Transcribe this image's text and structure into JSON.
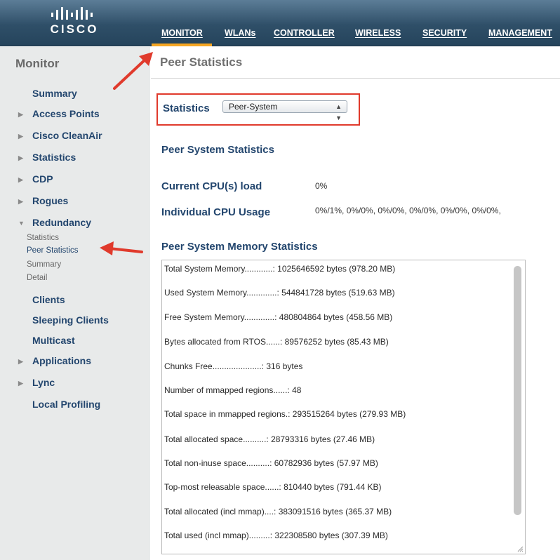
{
  "header": {
    "logo_text": "CISCO",
    "nav": [
      {
        "label": "MONITOR",
        "active": true
      },
      {
        "label": "WLANs",
        "active": false
      },
      {
        "label": "CONTROLLER",
        "active": false
      },
      {
        "label": "WIRELESS",
        "active": false
      },
      {
        "label": "SECURITY",
        "active": false
      },
      {
        "label": "MANAGEMENT",
        "active": false
      }
    ]
  },
  "sidebar": {
    "title": "Monitor",
    "items": [
      {
        "label": "Summary",
        "caret": ""
      },
      {
        "label": "Access Points",
        "caret": "▶"
      },
      {
        "label": "Cisco CleanAir",
        "caret": "▶"
      },
      {
        "label": "Statistics",
        "caret": "▶"
      },
      {
        "label": "CDP",
        "caret": "▶"
      },
      {
        "label": "Rogues",
        "caret": "▶"
      },
      {
        "label": "Redundancy",
        "caret": "▼"
      }
    ],
    "redundancy_sub": [
      "Statistics",
      "Peer Statistics",
      "Summary",
      "Detail"
    ],
    "items_after": [
      {
        "label": "Clients",
        "caret": ""
      },
      {
        "label": "Sleeping Clients",
        "caret": ""
      },
      {
        "label": "Multicast",
        "caret": ""
      },
      {
        "label": "Applications",
        "caret": "▶"
      },
      {
        "label": "Lync",
        "caret": "▶"
      },
      {
        "label": "Local Profiling",
        "caret": ""
      }
    ]
  },
  "main": {
    "title": "Peer Statistics",
    "statistics_label": "Statistics",
    "statistics_select": "Peer-System",
    "peer_system_heading": "Peer System Statistics",
    "cpu_load_label": "Current CPU(s) load",
    "cpu_load_value": "0%",
    "cpu_usage_label": "Individual CPU Usage",
    "cpu_usage_value": "0%/1%, 0%/0%, 0%/0%, 0%/0%, 0%/0%, 0%/0%,",
    "memory_heading": "Peer System Memory Statistics",
    "memory_lines": [
      "Total System Memory............: 1025646592 bytes (978.20 MB)",
      "Used System Memory.............: 544841728 bytes (519.63 MB)",
      "Free System Memory.............: 480804864 bytes (458.56 MB)",
      "Bytes allocated from RTOS......: 89576252 bytes (85.43 MB)",
      "Chunks Free.....................: 316 bytes",
      "Number of mmapped regions......: 48",
      "Total space in mmapped regions.: 293515264 bytes (279.93 MB)",
      "Total allocated space..........: 28793316 bytes (27.46 MB)",
      "Total non-inuse space..........: 60782936 bytes (57.97 MB)",
      "Top-most releasable space......: 810440 bytes (791.44 KB)",
      "Total allocated (incl mmap)....: 383091516 bytes (365.37 MB)",
      "Total used (incl mmap).........: 322308580 bytes (307.39 MB)"
    ]
  },
  "colors": {
    "header_bg": "#2f4f68",
    "nav_active_underline": "#f5a623",
    "sidebar_bg": "#e8eaea",
    "link_blue": "#23466e",
    "annotation_red": "#e03a2c"
  },
  "icons": [
    "cisco-logo",
    "caret-right-icon",
    "caret-down-icon",
    "select-updown-icon",
    "resize-grip-icon",
    "annotation-arrow"
  ]
}
